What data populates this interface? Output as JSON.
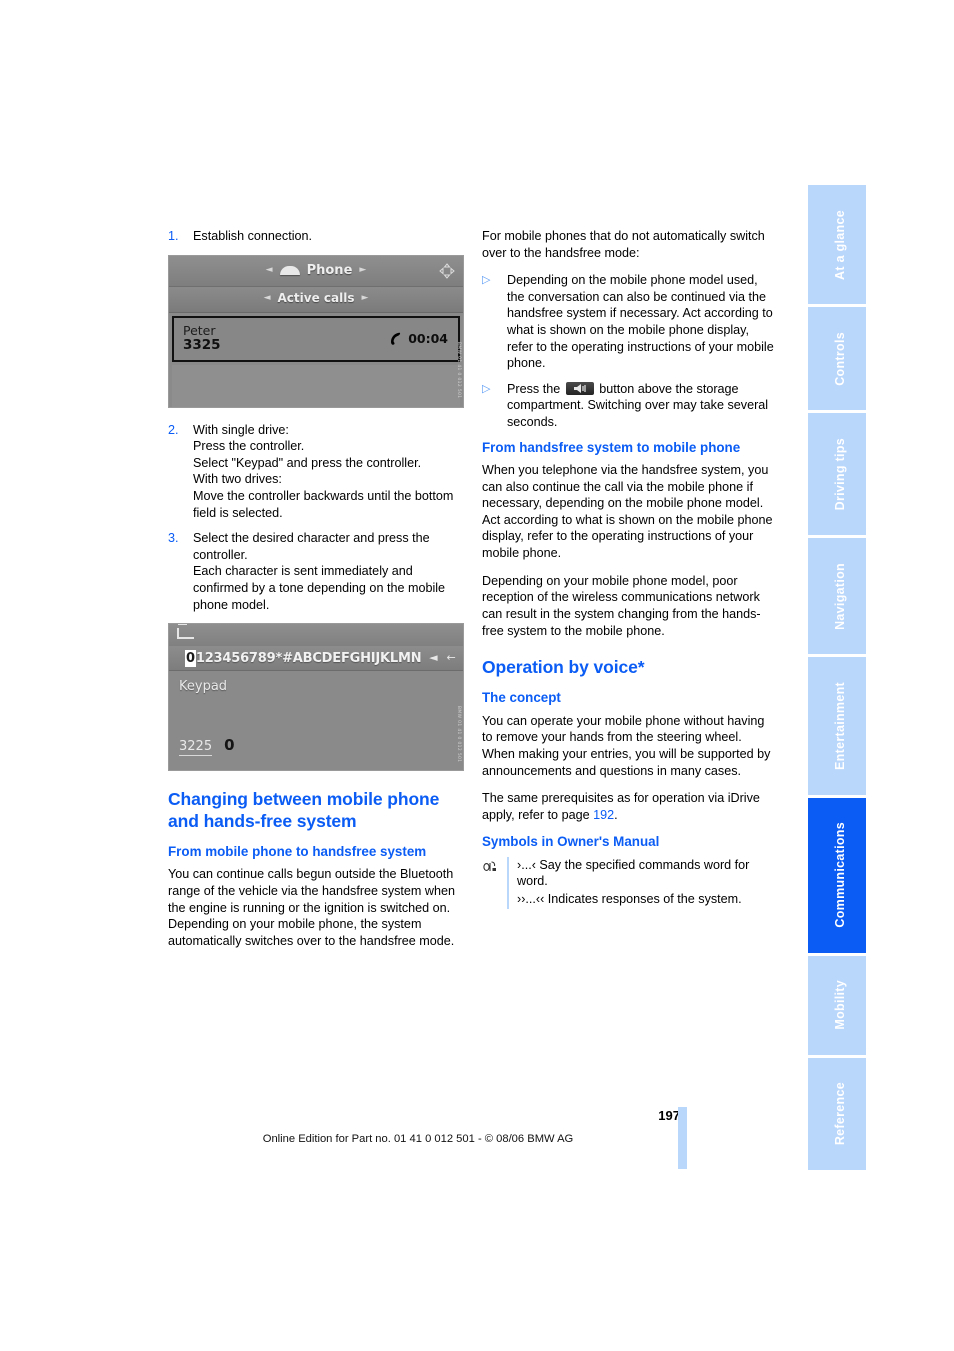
{
  "document": {
    "page_number": "197",
    "footer": "Online Edition for Part no. 01 41 0 012 501 - © 08/06 BMW AG"
  },
  "tabs": [
    {
      "label": "At a glance",
      "active": false
    },
    {
      "label": "Controls",
      "active": false
    },
    {
      "label": "Driving tips",
      "active": false
    },
    {
      "label": "Navigation",
      "active": false
    },
    {
      "label": "Entertainment",
      "active": false
    },
    {
      "label": "Communications",
      "active": true
    },
    {
      "label": "Mobility",
      "active": false
    },
    {
      "label": "Reference",
      "active": false
    }
  ],
  "colors": {
    "accent": "#0a5cf5",
    "tab_inactive": "#b9d6fb",
    "tab_active": "#0a5cf5",
    "display_gray": "#8a8a8a"
  },
  "left_column": {
    "step1": {
      "number": "1.",
      "text": "Establish connection."
    },
    "display1": {
      "title": "Phone",
      "subtitle": "Active calls",
      "caller_name": "Peter",
      "caller_number": "3325",
      "call_duration": "00:04",
      "arrow_left": "◄",
      "arrow_right": "►",
      "watermark": "BMW 01 41 0 012 501"
    },
    "step2": {
      "number": "2.",
      "line1": "With single drive:",
      "line2": "Press the controller.",
      "line3": "Select \"Keypad\" and press the controller.",
      "line4": "With two drives:",
      "line5": "Move the controller backwards until the bottom field is selected."
    },
    "step3": {
      "number": "3.",
      "line1": "Select the desired character and press the controller.",
      "line2": "Each character is sent immediately and confirmed by a tone depending on the mobile phone model."
    },
    "display2": {
      "selected_char": "0",
      "char_strip": "123456789*#ABCDEFGHIJKLMN",
      "button_prev": "◄",
      "button_back": "←",
      "label": "Keypad",
      "sent_digits": "3225",
      "current_char": "0",
      "watermark": "BMW 01 41 0 012 501"
    },
    "heading_main": "Changing between mobile phone and hands-free system",
    "heading_sub": "From mobile phone to handsfree system",
    "paragraph": "You can continue calls begun outside the Bluetooth range of the vehicle via the handsfree system when the engine is running or the ignition is switched on. Depending on your mobile phone, the system automatically switches over to the handsfree mode."
  },
  "right_column": {
    "intro": "For mobile phones that do not automatically switch over to the handsfree mode:",
    "bullet1": "Depending on the mobile phone model used, the conversation can also be continued via the handsfree system if necessary. Act according to what is shown on the mobile phone display, refer to the operating instructions of your mobile phone.",
    "bullet2_before": "Press the",
    "bullet2_after": "button above the storage compartment. Switching over may take several seconds.",
    "heading_hf_to_mobile": "From handsfree system to mobile phone",
    "para1": "When you telephone via the handsfree system, you can also continue the call via the mobile phone if necessary, depending on the mobile phone model. Act according to what is shown on the mobile phone display, refer to the operating instructions of your mobile phone.",
    "para2": "Depending on your mobile phone model, poor reception of the wireless communications network can result in the system changing from the hands-free system to the mobile phone.",
    "heading_voice": "Operation by voice*",
    "heading_concept": "The concept",
    "concept_para": "You can operate your mobile phone without having to remove your hands from the steering wheel. When making your entries, you will be supported by announcements and questions in many cases.",
    "prereq_before": "The same prerequisites as for operation via iDrive apply, refer to page",
    "prereq_link": "192",
    "prereq_after": ".",
    "heading_symbols": "Symbols in Owner's Manual",
    "symbol_say": "›...‹ Say the specified commands word for word.",
    "symbol_response": "››...‹‹ Indicates responses of the system."
  }
}
